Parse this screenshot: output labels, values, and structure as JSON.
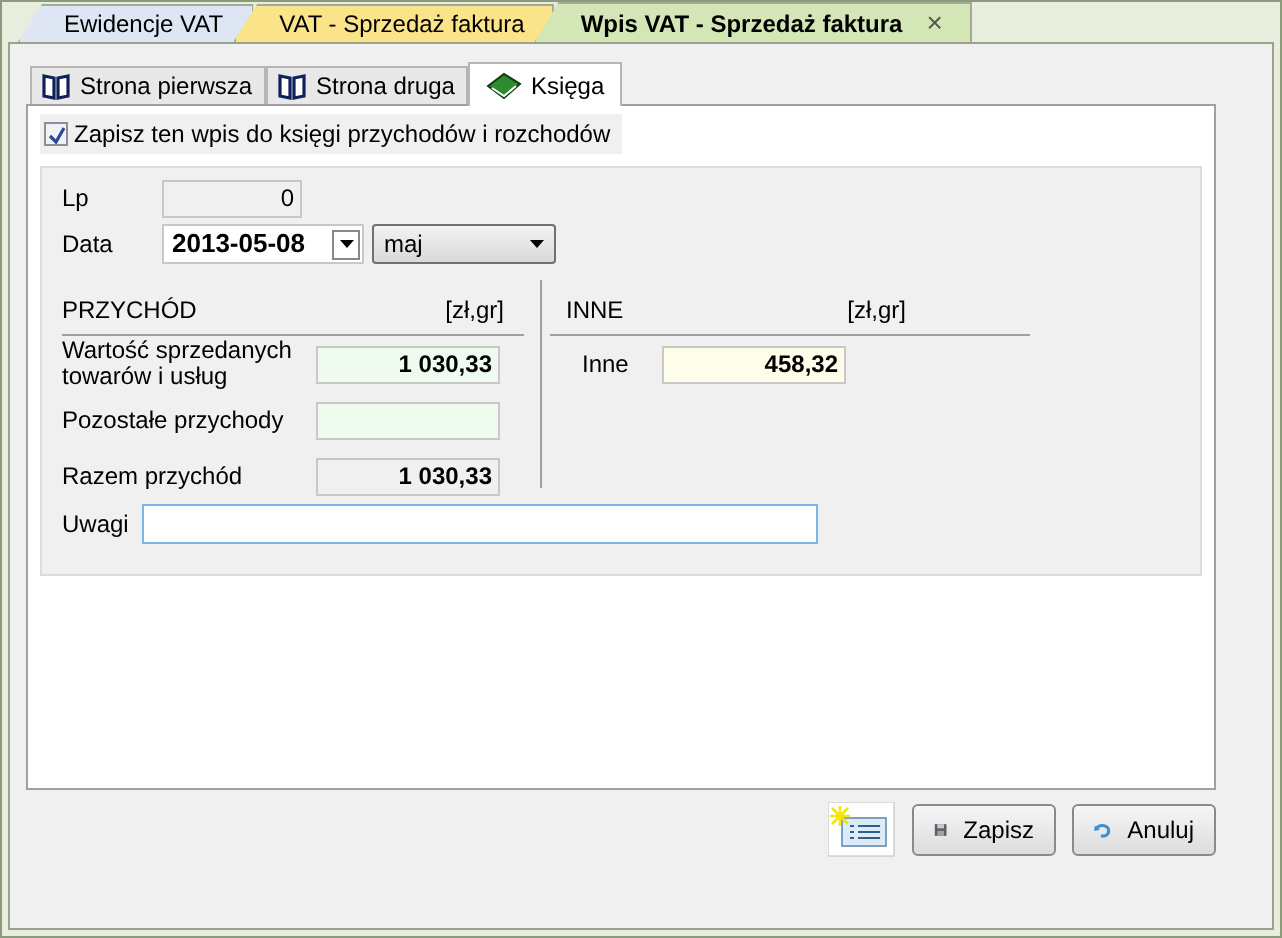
{
  "document_tabs": [
    {
      "label": "Ewidencje VAT",
      "selected": false,
      "color": "#dde6f2"
    },
    {
      "label": "VAT - Sprzedaż faktura",
      "selected": false,
      "color": "#fbe38a"
    },
    {
      "label": "Wpis VAT - Sprzedaż faktura",
      "selected": true,
      "color": "#d4e6b5",
      "close": "×"
    }
  ],
  "page_tabs": [
    {
      "label": "Strona pierwsza",
      "selected": false
    },
    {
      "label": "Strona druga",
      "selected": false
    },
    {
      "label": "Księga",
      "selected": true
    }
  ],
  "save_to_ledger": {
    "label": "Zapisz ten wpis do księgi przychodów i rozchodów",
    "checked": true
  },
  "lp": {
    "label": "Lp",
    "value": "0"
  },
  "date": {
    "label": "Data",
    "value": "2013-05-08",
    "month": "maj"
  },
  "income": {
    "heading": "PRZYCHÓD",
    "unit": "[zł,gr]",
    "rows": [
      {
        "label": "Wartość sprzedanych towarów i usług",
        "value": "1 030,33",
        "kind": "input"
      },
      {
        "label": "Pozostałe przychody",
        "kind": "input"
      },
      {
        "label": "Razem przychód",
        "value": "1 030,33",
        "kind": "readonly"
      }
    ]
  },
  "other": {
    "heading": "INNE",
    "unit": "[zł,gr]",
    "rows": [
      {
        "label": "Inne",
        "value": "458,32"
      }
    ]
  },
  "notes": {
    "label": "Uwagi"
  },
  "buttons": [
    {
      "label": "Zapisz"
    },
    {
      "label": "Anuluj"
    }
  ]
}
